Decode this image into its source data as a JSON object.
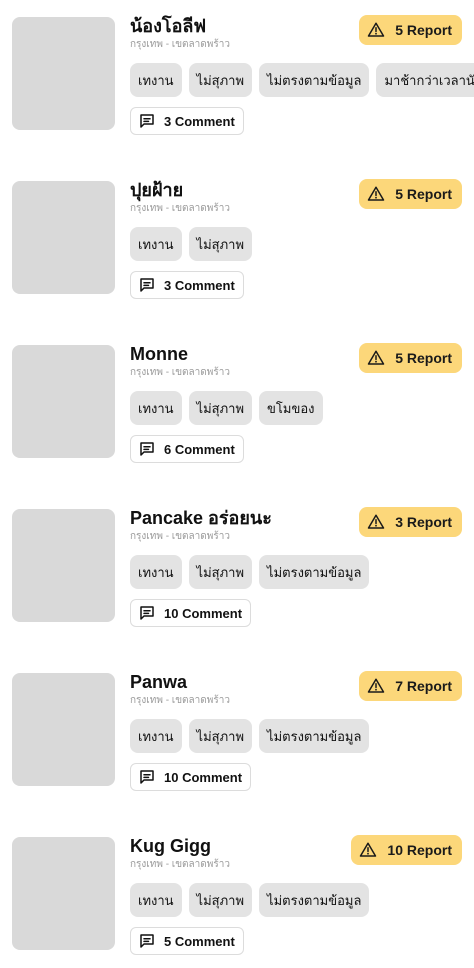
{
  "items": [
    {
      "name": "น้องโอลีฟ",
      "location": "กรุงเทพ - เขตลาดพร้าว",
      "report_label": "5 Report",
      "tags": [
        "เทงาน",
        "ไม่สุภาพ",
        "ไม่ตรงตามข้อมูล",
        "มาช้ากว่าเวลานัด"
      ],
      "comment_label": "3 Comment"
    },
    {
      "name": "ปุยฝ้าย",
      "location": "กรุงเทพ - เขตลาดพร้าว",
      "report_label": "5 Report",
      "tags": [
        "เทงาน",
        "ไม่สุภาพ"
      ],
      "comment_label": "3 Comment"
    },
    {
      "name": "Monne",
      "location": "กรุงเทพ - เขตลาดพร้าว",
      "report_label": "5 Report",
      "tags": [
        "เทงาน",
        "ไม่สุภาพ",
        "ขโมของ"
      ],
      "comment_label": "6 Comment"
    },
    {
      "name": "Pancake อร่อยนะ",
      "location": "กรุงเทพ - เขตลาดพร้าว",
      "report_label": "3 Report",
      "tags": [
        "เทงาน",
        "ไม่สุภาพ",
        "ไม่ตรงตามข้อมูล"
      ],
      "comment_label": "10 Comment"
    },
    {
      "name": "Panwa",
      "location": "กรุงเทพ - เขตลาดพร้าว",
      "report_label": "7 Report",
      "tags": [
        "เทงาน",
        "ไม่สุภาพ",
        "ไม่ตรงตามข้อมูล"
      ],
      "comment_label": "10 Comment"
    },
    {
      "name": "Kug Gigg",
      "location": "กรุงเทพ - เขตลาดพร้าว",
      "report_label": "10 Report",
      "tags": [
        "เทงาน",
        "ไม่สุภาพ",
        "ไม่ตรงตามข้อมูล"
      ],
      "comment_label": "5 Comment"
    }
  ],
  "icons": {
    "report": "warning-triangle-icon",
    "comment": "comment-icon"
  },
  "colors": {
    "report_badge_bg": "#fcd77a",
    "tag_bg": "#e3e3e3",
    "thumb_bg": "#d9d9d9"
  }
}
